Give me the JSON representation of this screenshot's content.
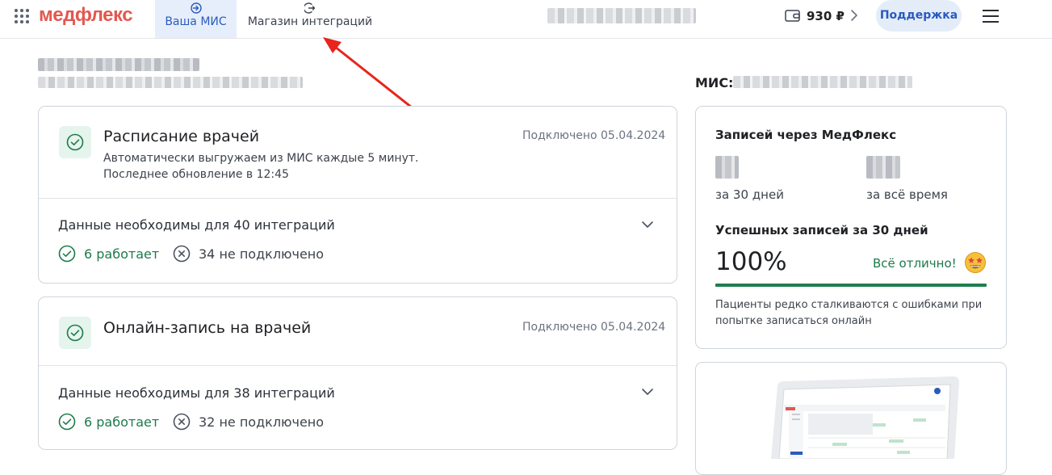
{
  "header": {
    "logo": "медфлекс",
    "tabs": [
      {
        "label": "Ваша МИС",
        "icon": "arrow-in-circle-icon",
        "active": true
      },
      {
        "label": "Магазин интеграций",
        "icon": "arrow-out-circle-icon",
        "active": false
      }
    ],
    "balance": "930 ₽",
    "support_label": "Поддержка"
  },
  "integrations": [
    {
      "title": "Расписание врачей",
      "description_line1": "Автоматически выгружаем из МИС каждые 5 минут.",
      "description_line2": "Последнее обновление в 12:45",
      "connected": "Подключено 05.04.2024",
      "needed": "Данные необходимы для 40 интеграций",
      "working": "6 работает",
      "not_connected": "34 не подключено"
    },
    {
      "title": "Онлайн-запись на врачей",
      "connected": "Подключено 05.04.2024",
      "needed": "Данные необходимы для 38 интеграций",
      "working": "6 работает",
      "not_connected": "32 не подключено"
    }
  ],
  "sidebar": {
    "mis_label": "МИС:",
    "stats_title": "Записей через МедФлекс",
    "period_30": "за 30 дней",
    "period_all": "за всё время",
    "success_title": "Успешных записей за 30 дней",
    "success_value": "100%",
    "success_status": "Всё отлично!",
    "success_fraction": 1.0,
    "note": "Пациенты редко сталкиваются с ошибками при попытке записаться онлайн"
  },
  "colors": {
    "brand": "#e2584f",
    "accent": "#2a5bbd",
    "success": "#1d7a4a",
    "annotation_arrow": "#e8241c"
  }
}
